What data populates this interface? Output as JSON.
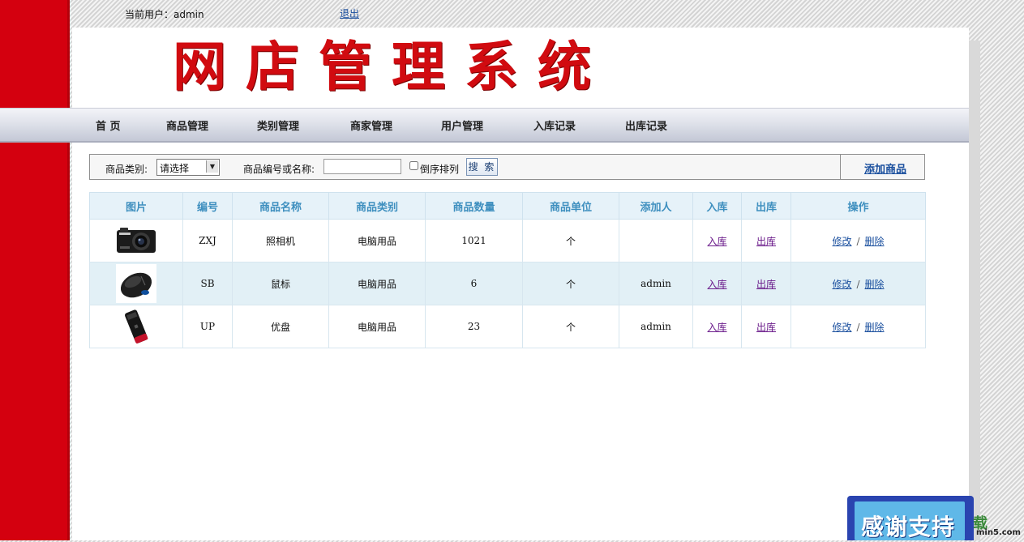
{
  "header": {
    "current_user": "当前用户：admin",
    "logout": "退出",
    "banner": "网店管理系统"
  },
  "nav": [
    {
      "label": "首 页"
    },
    {
      "label": "商品管理"
    },
    {
      "label": "类别管理"
    },
    {
      "label": "商家管理"
    },
    {
      "label": "用户管理"
    },
    {
      "label": "入库记录"
    },
    {
      "label": "出库记录"
    }
  ],
  "search": {
    "category_label": "商品类别:",
    "category_selected": "请选择",
    "keyword_label": "商品编号或名称:",
    "keyword_value": "",
    "reverse_label": "倒序排列",
    "button": "搜 索",
    "add_product": "添加商品"
  },
  "table": {
    "headers": [
      "图片",
      "编号",
      "商品名称",
      "商品类别",
      "商品数量",
      "商品单位",
      "添加人",
      "入库",
      "出库",
      "操作"
    ],
    "rows": [
      {
        "image": "camera-image",
        "code": "ZXJ",
        "name": "照相机",
        "category": "电脑用品",
        "quantity": "1021",
        "unit": "个",
        "added_by": "",
        "in": "入库",
        "out": "出库",
        "edit": "修改",
        "sep": "/",
        "delete": "删除"
      },
      {
        "image": "mouse-image",
        "code": "SB",
        "name": "鼠标",
        "category": "电脑用品",
        "quantity": "6",
        "unit": "个",
        "added_by": "admin",
        "in": "入库",
        "out": "出库",
        "edit": "修改",
        "sep": "/",
        "delete": "删除"
      },
      {
        "image": "usb-drive-image",
        "code": "UP",
        "name": "优盘",
        "category": "电脑用品",
        "quantity": "23",
        "unit": "个",
        "added_by": "admin",
        "in": "入库",
        "out": "出库",
        "edit": "修改",
        "sep": "/",
        "delete": "删除"
      }
    ]
  },
  "overlay": {
    "thanks": "感谢支持",
    "watermark_char": "载",
    "watermark_url": "min5.com"
  },
  "colors": {
    "brand_red": "#d4000f",
    "title_red": "#d10b10",
    "header_blue": "#3e8fbf",
    "link_blue": "#1a4f9e",
    "link_purple": "#6a1a8a",
    "row_alt": "#e2f0f6"
  }
}
